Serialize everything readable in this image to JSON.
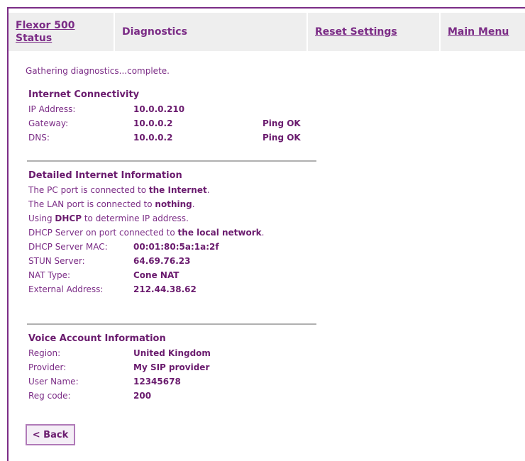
{
  "nav": {
    "status_label": "Flexor 500 Status",
    "diagnostics_label": "Diagnostics",
    "reset_label": "Reset Settings",
    "main_menu_label": "Main Menu"
  },
  "status_message": "Gathering diagnostics...complete.",
  "connectivity": {
    "title": "Internet Connectivity",
    "rows": [
      {
        "label": "IP Address:",
        "value": "10.0.0.210",
        "extra": ""
      },
      {
        "label": "Gateway:",
        "value": "10.0.0.2",
        "extra": "Ping OK"
      },
      {
        "label": "DNS:",
        "value": "10.0.0.2",
        "extra": "Ping OK"
      }
    ]
  },
  "detailed": {
    "title": "Detailed Internet Information",
    "lines": [
      {
        "pre": "The PC port is connected to ",
        "bold": "the Internet",
        "post": "."
      },
      {
        "pre": "The LAN port is connected to ",
        "bold": "nothing",
        "post": "."
      },
      {
        "pre": "Using ",
        "bold": "DHCP",
        "post": " to determine IP address."
      },
      {
        "pre": "DHCP Server on port connected to ",
        "bold": "the local network",
        "post": "."
      }
    ],
    "rows": [
      {
        "label": "DHCP Server MAC:",
        "value": "00:01:80:5a:1a:2f"
      },
      {
        "label": "STUN Server:",
        "value": "64.69.76.23"
      },
      {
        "label": "NAT Type:",
        "value": "Cone NAT"
      },
      {
        "label": "External Address:",
        "value": "212.44.38.62"
      }
    ]
  },
  "voice": {
    "title": "Voice Account Information",
    "rows": [
      {
        "label": "Region:",
        "value": "United Kingdom"
      },
      {
        "label": "Provider:",
        "value": "My SIP provider"
      },
      {
        "label": "User Name:",
        "value": "12345678"
      },
      {
        "label": "Reg code:",
        "value": "200"
      }
    ]
  },
  "back_label": "< Back",
  "colors": {
    "text": "#6a1b6e",
    "accent": "#7b2c86",
    "nav_bg": "#eeeeee"
  }
}
